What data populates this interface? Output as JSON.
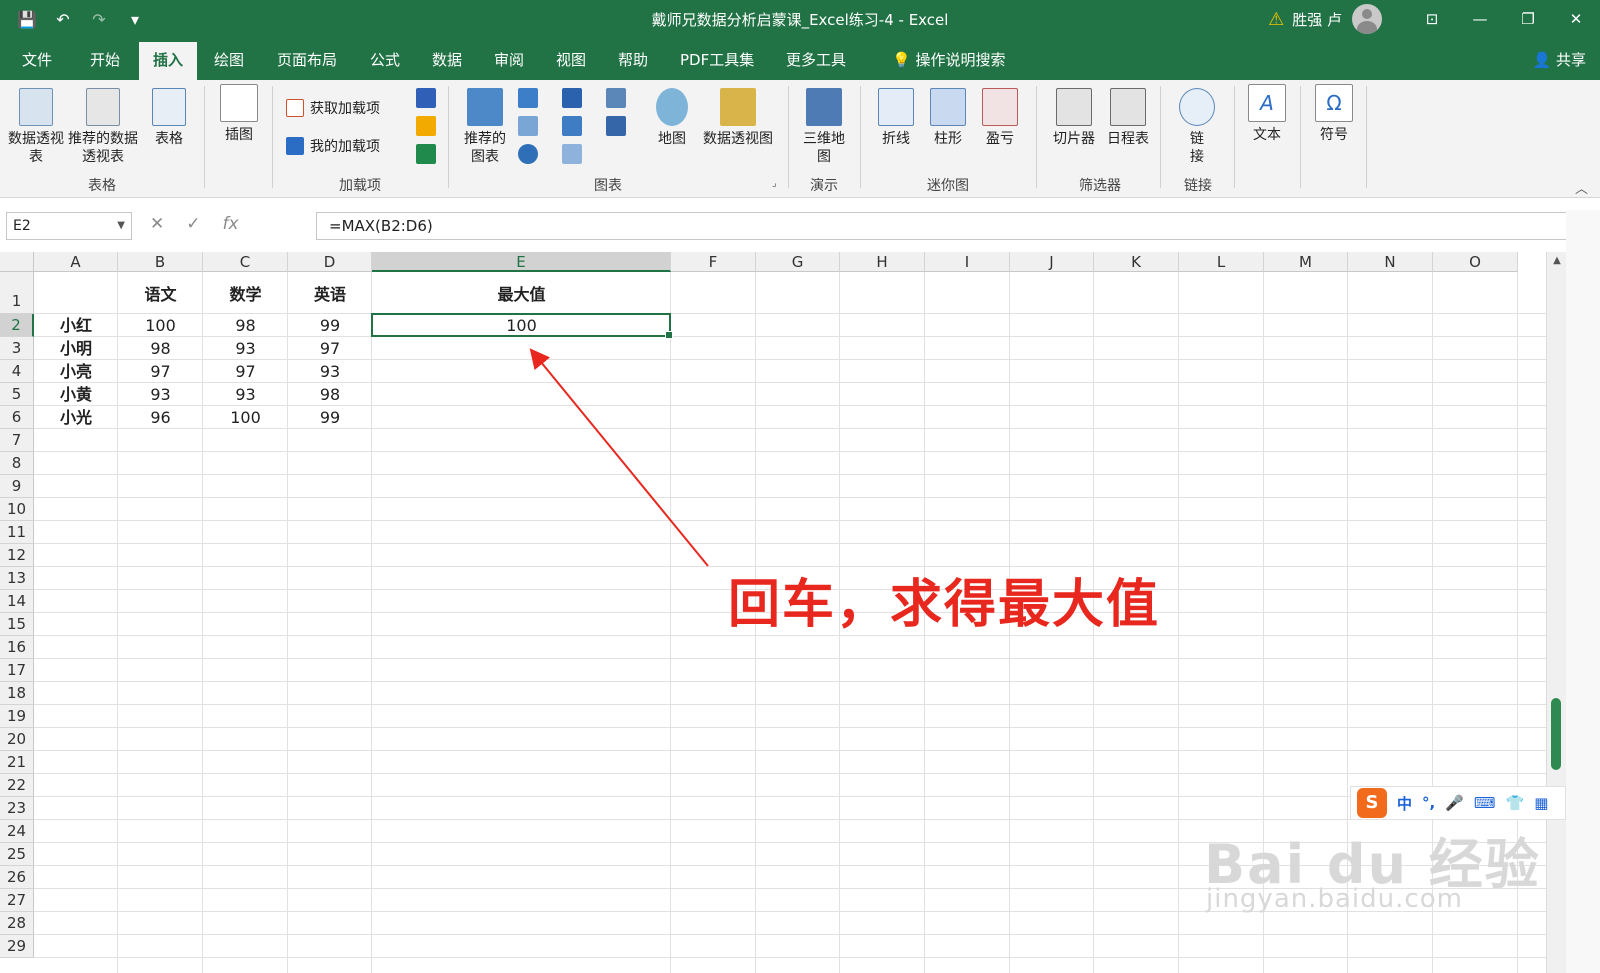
{
  "title": {
    "text": "戴师兄数据分析启蒙课_Excel练习-4  -  Excel",
    "user": "胜强 卢"
  },
  "tabs": [
    "文件",
    "开始",
    "插入",
    "绘图",
    "页面布局",
    "公式",
    "数据",
    "审阅",
    "视图",
    "帮助",
    "PDF工具集",
    "更多工具",
    "操作说明搜索"
  ],
  "active_tab": "插入",
  "share": "共享",
  "ribbon": {
    "pivot_table": "数据透视表",
    "recommended_pivot": "推荐的数据透视表",
    "table": "表格",
    "group_table": "表格",
    "illustrations": "插图",
    "get_addins": "获取加载项",
    "my_addins": "我的加载项",
    "group_addins": "加载项",
    "recommended_charts": "推荐的图表",
    "maps": "地图",
    "pivot_chart": "数据透视图",
    "group_charts": "图表",
    "map3d": "三维地图",
    "group_tours": "演示",
    "line": "折线",
    "column": "柱形",
    "winloss": "盈亏",
    "group_sparklines": "迷你图",
    "slicer": "切片器",
    "timeline": "日程表",
    "group_filters": "筛选器",
    "link": "链接",
    "group_links": "链接",
    "text": "文本",
    "symbols": "符号"
  },
  "formula_bar": {
    "name_box": "E2",
    "formula": "=MAX(B2:D6)"
  },
  "columns": [
    "A",
    "B",
    "C",
    "D",
    "E",
    "F",
    "G",
    "H",
    "I",
    "J",
    "K",
    "L",
    "M",
    "N",
    "O"
  ],
  "sheet": {
    "headers": [
      "",
      "语文",
      "数学",
      "英语",
      "最大值"
    ],
    "rows": [
      {
        "name": "小红",
        "b": "100",
        "c": "98",
        "d": "99",
        "e": "100"
      },
      {
        "name": "小明",
        "b": "98",
        "c": "93",
        "d": "97",
        "e": ""
      },
      {
        "name": "小亮",
        "b": "97",
        "c": "97",
        "d": "93",
        "e": ""
      },
      {
        "name": "小黄",
        "b": "93",
        "c": "93",
        "d": "98",
        "e": ""
      },
      {
        "name": "小光",
        "b": "96",
        "c": "100",
        "d": "99",
        "e": ""
      }
    ]
  },
  "annotation": "回车，求得最大值",
  "ime": {
    "logo": "S",
    "items": [
      "中",
      "°,",
      "🎤",
      "⌨",
      "👕",
      "▦"
    ]
  },
  "watermark": {
    "line1": "Bai du 经验",
    "line2": "jingyan.baidu.com"
  },
  "colors": {
    "excel_green": "#217346",
    "annotation_red": "#e8281e"
  }
}
